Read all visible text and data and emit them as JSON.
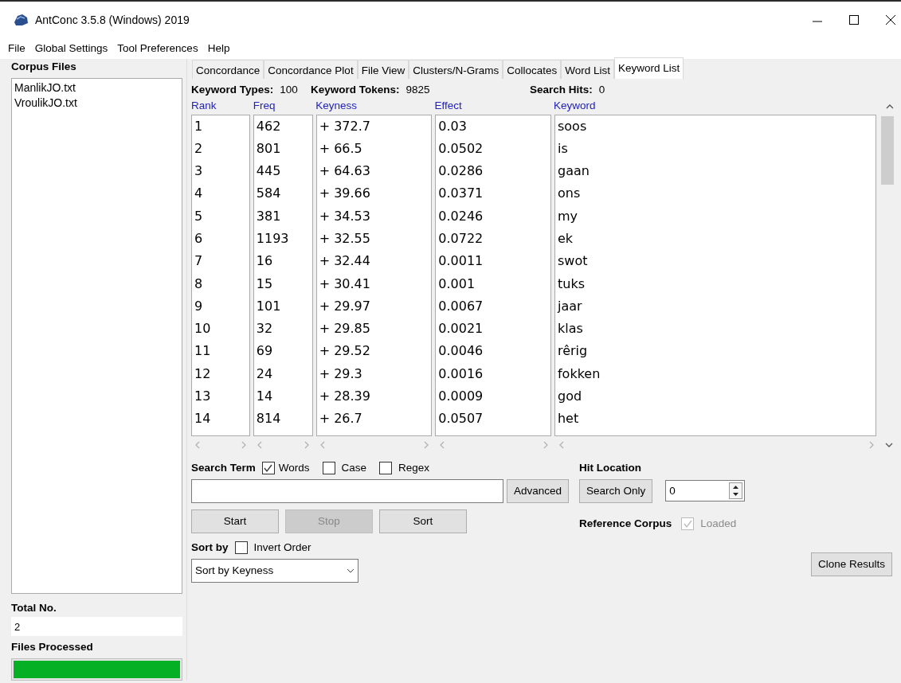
{
  "window": {
    "title": "AntConc 3.5.8 (Windows) 2019"
  },
  "menu": [
    "File",
    "Global Settings",
    "Tool Preferences",
    "Help"
  ],
  "sidebar": {
    "title": "Corpus Files",
    "files": [
      "ManlikJO.txt",
      "VroulikJO.txt"
    ],
    "total_label": "Total No.",
    "total_value": "2",
    "processed_label": "Files Processed",
    "progress": {
      "level": 1
    }
  },
  "tabs": [
    {
      "label": "Concordance",
      "selected": false
    },
    {
      "label": "Concordance Plot",
      "selected": false
    },
    {
      "label": "File View",
      "selected": false
    },
    {
      "label": "Clusters/N-Grams",
      "selected": false
    },
    {
      "label": "Collocates",
      "selected": false
    },
    {
      "label": "Word List",
      "selected": false
    },
    {
      "label": "Keyword List",
      "selected": true
    }
  ],
  "stats": [
    {
      "label": "Keyword Types:",
      "value": "100"
    },
    {
      "label": "Keyword Tokens:",
      "value": "9825"
    },
    {
      "label": "Search Hits:",
      "value": "0"
    }
  ],
  "table": {
    "columns": [
      "Rank",
      "Freq",
      "Keyness",
      "Effect",
      "Keyword"
    ],
    "rows": [
      [
        "1",
        "462",
        "+ 372.7",
        "0.03",
        "soos"
      ],
      [
        "2",
        "801",
        "+ 66.5",
        "0.0502",
        "is"
      ],
      [
        "3",
        "445",
        "+ 64.63",
        "0.0286",
        "gaan"
      ],
      [
        "4",
        "584",
        "+ 39.66",
        "0.0371",
        "ons"
      ],
      [
        "5",
        "381",
        "+ 34.53",
        "0.0246",
        "my"
      ],
      [
        "6",
        "1193",
        "+ 32.55",
        "0.0722",
        "ek"
      ],
      [
        "7",
        "16",
        "+ 32.44",
        "0.0011",
        "swot"
      ],
      [
        "8",
        "15",
        "+ 30.41",
        "0.001",
        "tuks"
      ],
      [
        "9",
        "101",
        "+ 29.97",
        "0.0067",
        "jaar"
      ],
      [
        "10",
        "32",
        "+ 29.85",
        "0.0021",
        "klas"
      ],
      [
        "11",
        "69",
        "+ 29.52",
        "0.0046",
        "rêrig"
      ],
      [
        "12",
        "24",
        "+ 29.3",
        "0.0016",
        "fokken"
      ],
      [
        "13",
        "14",
        "+ 28.39",
        "0.0009",
        "god"
      ],
      [
        "14",
        "814",
        "+ 26.7",
        "0.0507",
        "het"
      ]
    ]
  },
  "search": {
    "label": "Search Term",
    "options": [
      {
        "label": "Words",
        "checked": true
      },
      {
        "label": "Case",
        "checked": false
      },
      {
        "label": "Regex",
        "checked": false
      }
    ],
    "advanced_button": "Advanced"
  },
  "actions": [
    {
      "label": "Start",
      "disabled": false
    },
    {
      "label": "Stop",
      "disabled": true
    },
    {
      "label": "Sort",
      "disabled": false
    }
  ],
  "sort": {
    "label": "Sort by",
    "invert": {
      "label": "Invert Order",
      "checked": false
    },
    "value": "Sort by Keyness"
  },
  "hit_location": {
    "label": "Hit Location",
    "button": "Search Only",
    "value": "0"
  },
  "reference": {
    "label": "Reference Corpus",
    "checkbox": {
      "label": "Loaded",
      "checked": true,
      "disabled": true
    }
  },
  "clone_button": "Clone Results"
}
